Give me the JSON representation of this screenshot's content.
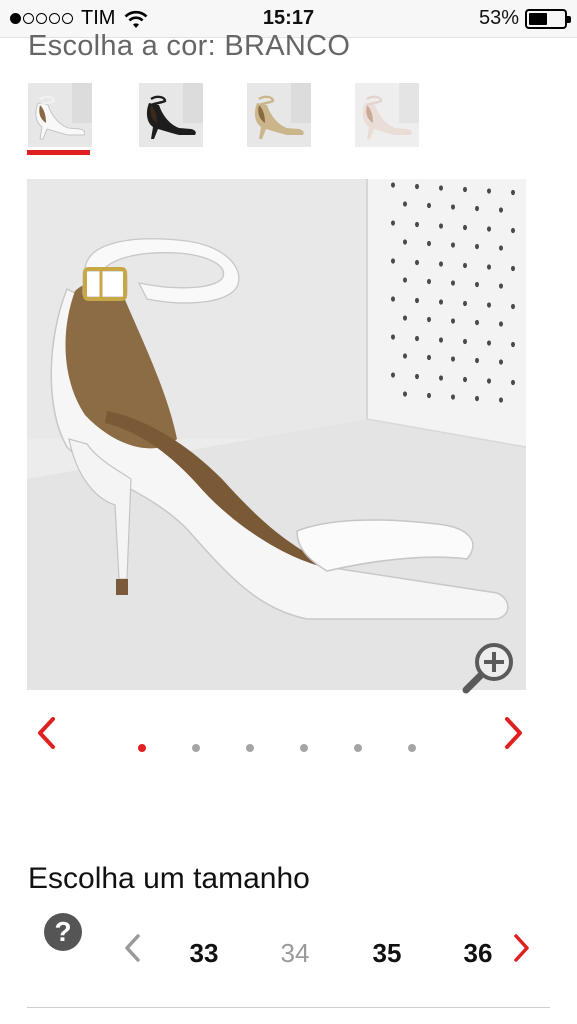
{
  "status_bar": {
    "carrier": "TIM",
    "time": "15:17",
    "battery_percent_label": "53%",
    "battery_level": 0.53,
    "signal_bars_filled": 1,
    "signal_bars_total": 5
  },
  "color_picker": {
    "heading": "Escolha a cor: BRANCO",
    "selected_index": 0,
    "accent_color": "#e02020",
    "options": [
      {
        "name": "branco-thumb",
        "shoe_color": "#f2f2f2"
      },
      {
        "name": "preto-thumb",
        "shoe_color": "#1a1a1a"
      },
      {
        "name": "dourado-thumb",
        "shoe_color": "#c9b48a"
      },
      {
        "name": "nude-thumb",
        "shoe_color": "#e6d8d2"
      }
    ]
  },
  "product_image": {
    "description_icon": "white-sandal-photo",
    "zoom_icon": "zoom-in-icon"
  },
  "carousel": {
    "prev_icon": "chevron-left-icon",
    "next_icon": "chevron-right-icon",
    "page_count": 6,
    "active_page": 0
  },
  "size_picker": {
    "heading": "Escolha um tamanho",
    "help_label": "?",
    "sizes": [
      {
        "label": "33",
        "available": true
      },
      {
        "label": "34",
        "available": false
      },
      {
        "label": "35",
        "available": true
      },
      {
        "label": "36",
        "available": true
      }
    ]
  }
}
